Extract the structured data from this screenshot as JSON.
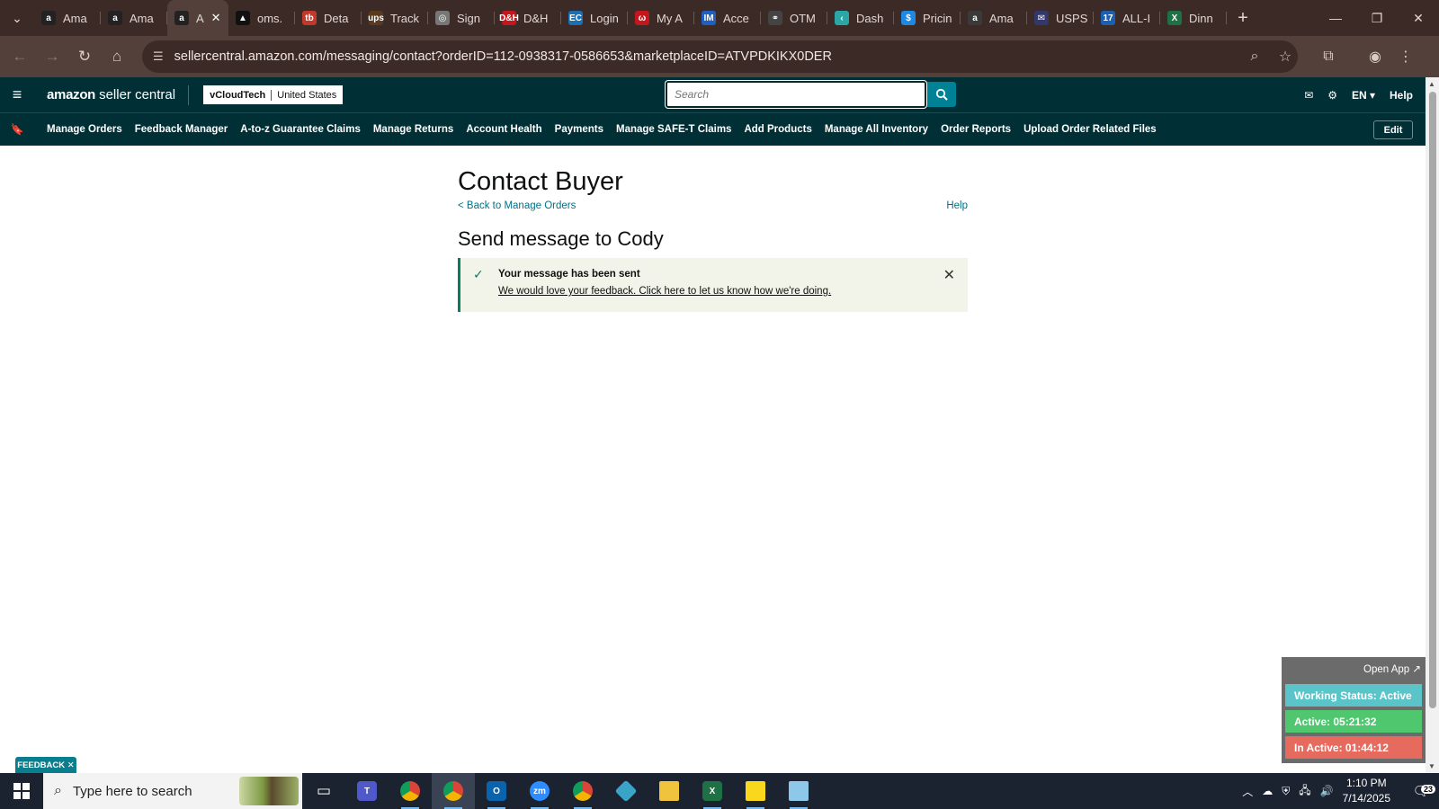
{
  "browser": {
    "tabs": [
      {
        "label": "Ama",
        "fav": "a",
        "color": "#222222"
      },
      {
        "label": "Ama",
        "fav": "a",
        "color": "#222222"
      },
      {
        "label": "A",
        "fav": "a",
        "color": "#222222",
        "active": true
      },
      {
        "label": "oms.",
        "fav": "▲",
        "color": "#111111"
      },
      {
        "label": "Deta",
        "fav": "tb",
        "color": "#c0392b"
      },
      {
        "label": "Track",
        "fav": "ups",
        "color": "#5a3a1e"
      },
      {
        "label": "Sign",
        "fav": "◎",
        "color": "#777777"
      },
      {
        "label": "D&H",
        "fav": "D&H",
        "color": "#c4161c"
      },
      {
        "label": "Login",
        "fav": "EC",
        "color": "#1b6fb5"
      },
      {
        "label": "My A",
        "fav": "ω",
        "color": "#c4161c"
      },
      {
        "label": "Acce",
        "fav": "IM",
        "color": "#1f5fbf"
      },
      {
        "label": "OTM",
        "fav": "⚭",
        "color": "#444444"
      },
      {
        "label": "Dash",
        "fav": "‹",
        "color": "#2aa6a6"
      },
      {
        "label": "Pricin",
        "fav": "$",
        "color": "#1e88e5"
      },
      {
        "label": "Ama",
        "fav": "a",
        "color": "#3a3a3a"
      },
      {
        "label": "USPS",
        "fav": "✉",
        "color": "#33386b"
      },
      {
        "label": "ALL-I",
        "fav": "17",
        "color": "#1b5fb3"
      },
      {
        "label": "Dinn",
        "fav": "X",
        "color": "#1e7145"
      }
    ],
    "url": "sellercentral.amazon.com/messaging/contact?orderID=112-0938317-0586653&marketplaceID=ATVPDKIKX0DER"
  },
  "header": {
    "logo_brand": "amazon",
    "logo_product": "seller central",
    "account_name": "vCloudTech",
    "marketplace": "United States",
    "search_placeholder": "Search",
    "language": "EN",
    "help": "Help"
  },
  "nav": {
    "links": [
      "Manage Orders",
      "Feedback Manager",
      "A-to-z Guarantee Claims",
      "Manage Returns",
      "Account Health",
      "Payments",
      "Manage SAFE-T Claims",
      "Add Products",
      "Manage All Inventory",
      "Order Reports",
      "Upload Order Related Files"
    ],
    "edit": "Edit"
  },
  "main": {
    "title": "Contact Buyer",
    "back_link": "< Back to Manage Orders",
    "help_link": "Help",
    "subtitle": "Send message to Cody",
    "alert_title": "Your message has been sent",
    "alert_feedback": "We would love your feedback. Click here to let us know how we're doing."
  },
  "tracker": {
    "open_app": "Open App ↗",
    "status": "Working Status: Active",
    "active": "Active: 05:21:32",
    "inactive": "In Active: 01:44:12"
  },
  "feedback_tab": "FEEDBACK ✕",
  "taskbar": {
    "search_placeholder": "Type here to search",
    "time": "1:10 PM",
    "date": "7/14/2025",
    "notifications": "23"
  }
}
